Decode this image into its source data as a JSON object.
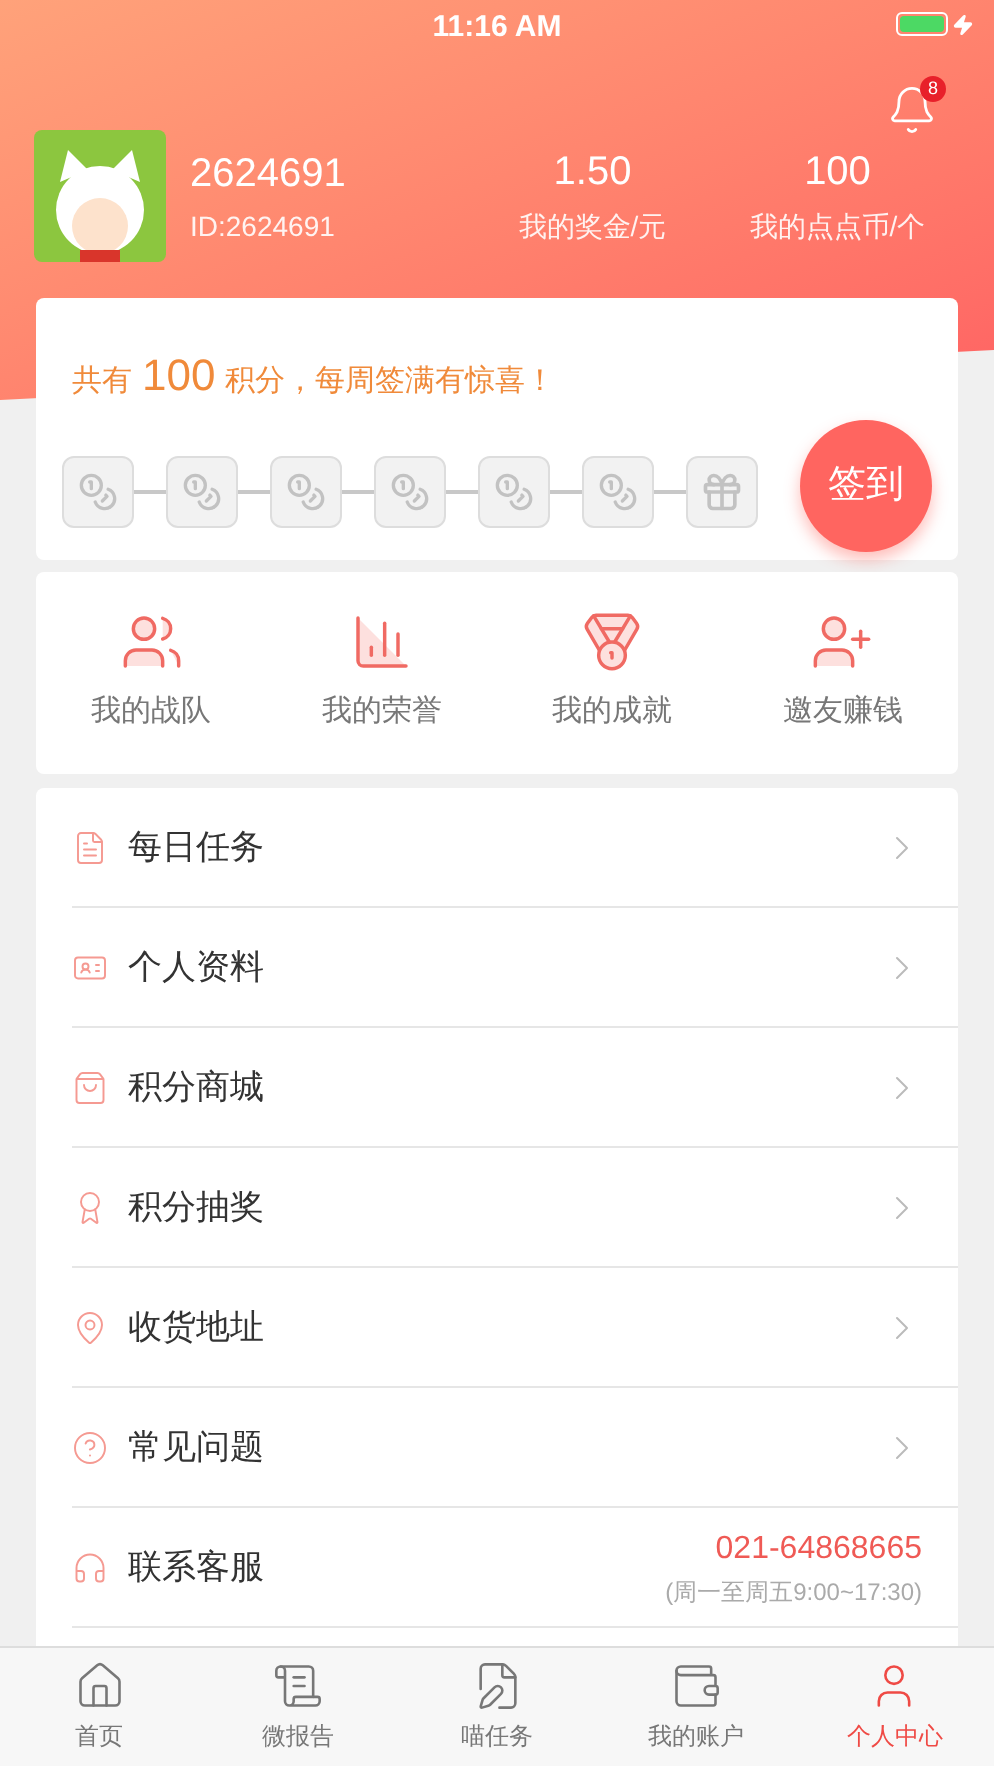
{
  "status_bar": {
    "time": "11:16 AM"
  },
  "profile": {
    "name": "2624691",
    "id": "ID:2624691",
    "notifications": "8",
    "stats": [
      {
        "value": "1.50",
        "label": "我的奖金/元"
      },
      {
        "value": "100",
        "label": "我的点点币/个"
      }
    ]
  },
  "checkin": {
    "prefix": "共有",
    "points": "100",
    "suffix": "积分，每周签满有惊喜！",
    "button": "签到",
    "days": [
      {
        "kind": "coin",
        "checked": false
      },
      {
        "kind": "coin",
        "checked": false
      },
      {
        "kind": "coin",
        "checked": false
      },
      {
        "kind": "coin",
        "checked": false
      },
      {
        "kind": "coin",
        "checked": false
      },
      {
        "kind": "coin",
        "checked": false
      },
      {
        "kind": "gift",
        "checked": false
      }
    ]
  },
  "shortcuts": [
    {
      "kind": "team",
      "label": "我的战队"
    },
    {
      "kind": "honor",
      "label": "我的荣誉"
    },
    {
      "kind": "medal",
      "label": "我的成就"
    },
    {
      "kind": "invite",
      "label": "邀友赚钱"
    }
  ],
  "menu": [
    {
      "kind": "task",
      "label": "每日任务"
    },
    {
      "kind": "card",
      "label": "个人资料"
    },
    {
      "kind": "bag",
      "label": "积分商城"
    },
    {
      "kind": "award",
      "label": "积分抽奖"
    },
    {
      "kind": "pin",
      "label": "收货地址"
    },
    {
      "kind": "help",
      "label": "常见问题"
    },
    {
      "kind": "service",
      "label": "联系客服",
      "phone": "021-64868665",
      "hours": "(周一至周五9:00~17:30)"
    }
  ],
  "tabs": [
    {
      "kind": "home",
      "label": "首页",
      "selected": false
    },
    {
      "kind": "report",
      "label": "微报告",
      "selected": false
    },
    {
      "kind": "task",
      "label": "喵任务",
      "selected": false
    },
    {
      "kind": "wallet",
      "label": "我的账户",
      "selected": false
    },
    {
      "kind": "user",
      "label": "个人中心",
      "selected": true
    }
  ]
}
